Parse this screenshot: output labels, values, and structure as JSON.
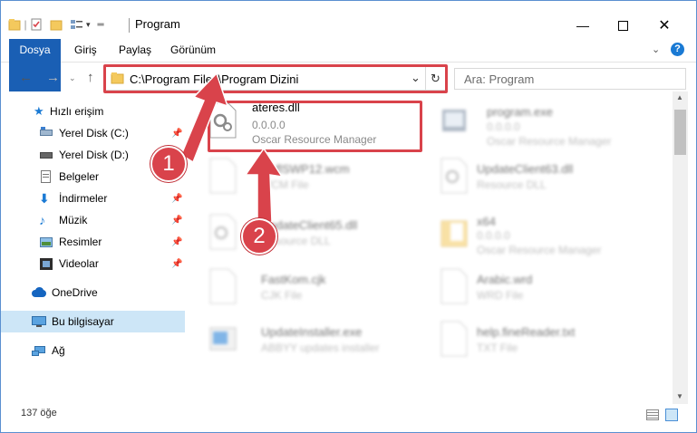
{
  "window": {
    "title": "Program"
  },
  "ribbon": {
    "tabs": [
      "Dosya",
      "Giriş",
      "Paylaş",
      "Görünüm"
    ]
  },
  "address": {
    "path": "C:\\Program Files\\Program Dizini"
  },
  "search": {
    "placeholder": "Ara: Program"
  },
  "sidebar": {
    "items": [
      {
        "label": "Hızlı erişim",
        "icon": "star-icon"
      },
      {
        "label": "Yerel Disk (C:)",
        "icon": "drive-c-icon"
      },
      {
        "label": "Yerel Disk (D:)",
        "icon": "drive-d-icon"
      },
      {
        "label": "Belgeler",
        "icon": "documents-icon"
      },
      {
        "label": "İndirmeler",
        "icon": "downloads-icon"
      },
      {
        "label": "Müzik",
        "icon": "music-icon"
      },
      {
        "label": "Resimler",
        "icon": "pictures-icon"
      },
      {
        "label": "Videolar",
        "icon": "videos-icon"
      },
      {
        "label": "OneDrive",
        "icon": "onedrive-icon"
      },
      {
        "label": "Bu bilgisayar",
        "icon": "computer-icon"
      },
      {
        "label": "Ağ",
        "icon": "network-icon"
      }
    ]
  },
  "files": [
    {
      "name": "ateres.dll",
      "line2": "0.0.0.0",
      "line3": "Oscar Resource Manager"
    },
    {
      "name": "program.exe",
      "line2": "0.0.0.0",
      "line3": "Oscar Resource Manager"
    },
    {
      "name": "ReflSWP12.wcm",
      "line2": "WCM File",
      "line3": ""
    },
    {
      "name": "UpdateClient63.dll",
      "line2": "Resource DLL",
      "line3": ""
    },
    {
      "name": "UpdateClient65.dll",
      "line2": "Resource DLL",
      "line3": ""
    },
    {
      "name": "x64",
      "line2": "0.0.0.0",
      "line3": "Oscar Resource Manager"
    },
    {
      "name": "FastKom.cjk",
      "line2": "CJK File",
      "line3": ""
    },
    {
      "name": "Arabic.wrd",
      "line2": "WRD File",
      "line3": ""
    },
    {
      "name": "UpdateInstaller.exe",
      "line2": "ABBYY updates installer",
      "line3": ""
    },
    {
      "name": "help.fineReader.txt",
      "line2": "TXT File",
      "line3": ""
    }
  ],
  "status": {
    "count": "137 öğe"
  },
  "markers": [
    "1",
    "2"
  ],
  "colors": {
    "accent": "#1a5fb4",
    "highlight": "#d9434b",
    "selected": "#cde6f7"
  }
}
